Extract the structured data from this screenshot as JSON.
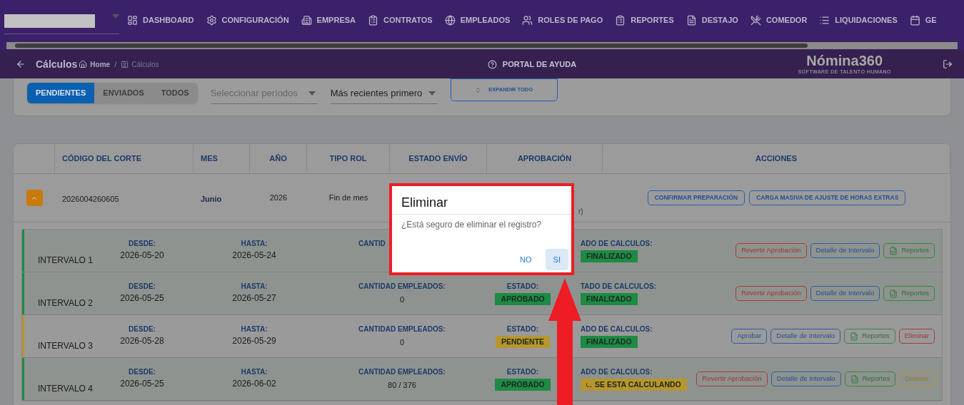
{
  "top_nav": {
    "items": [
      {
        "label": "DASHBOARD"
      },
      {
        "label": "CONFIGURACIÓN"
      },
      {
        "label": "EMPRESA"
      },
      {
        "label": "CONTRATOS"
      },
      {
        "label": "EMPLEADOS"
      },
      {
        "label": "ROLES DE PAGO"
      },
      {
        "label": "REPORTES"
      },
      {
        "label": "DESTAJO"
      },
      {
        "label": "COMEDOR"
      },
      {
        "label": "LIQUIDACIONES"
      },
      {
        "label": "GE"
      }
    ]
  },
  "header": {
    "title": "Cálculos",
    "breadcrumb": [
      "Home",
      "Cálculos"
    ],
    "breadcrumb_separator": "/",
    "help": "PORTAL DE AYUDA",
    "logo": {
      "name": "Nómina360",
      "tagline": "SOFTWARE DE TALENTO HUMANO"
    }
  },
  "filters": {
    "tabs": [
      {
        "label": "PENDIENTES",
        "selected": true
      },
      {
        "label": "ENVIADOS",
        "selected": false
      },
      {
        "label": "TODOS",
        "selected": false
      }
    ],
    "period": {
      "placeholder": "Seleccionar períodos"
    },
    "sort": {
      "value": "Más recientes primero"
    },
    "expand_button": "EXPANDIR TODO"
  },
  "table": {
    "columns": [
      "CÓDIGO DEL CORTE",
      "MES",
      "AÑO",
      "TIPO ROL",
      "ESTADO ENVÍO",
      "APROBACIÓN",
      "ACCIONES"
    ],
    "row": {
      "expanded": true,
      "code": "2026004260605",
      "month": "Junio",
      "year": "2026",
      "type": "Fin de mes",
      "approval_note": "r)",
      "actions": [
        "CONFIRMAR PREPARACIÓN",
        "CARGA MASIVA DE AJUSTE DE HORAS EXTRAS"
      ]
    }
  },
  "intervals": [
    {
      "name": "INTERVALO 1",
      "color": "#1e8a45",
      "desde_label": "DESDE:",
      "desde": "2026-05-20",
      "hasta_label": "HASTA:",
      "hasta": "2026-05-24",
      "cantidad_label": "CANTID",
      "calc_label": "ADO DE CALCULOS:",
      "calc": {
        "text": "FINALIZADO",
        "color": "#1e8a45",
        "loading": false
      },
      "actions": [
        {
          "label": "Revertir Aprobación",
          "kind": "danger"
        },
        {
          "label": "Detalle de Intervalo",
          "kind": "info"
        },
        {
          "label": "Reportes",
          "kind": "report"
        }
      ]
    },
    {
      "name": "INTERVALO 2",
      "color": "#1e8a45",
      "desde_label": "DESDE:",
      "desde": "2026-05-25",
      "hasta_label": "HASTA:",
      "hasta": "2026-05-27",
      "cantidad_label": "CANTIDAD EMPLEADOS:",
      "cantidad": "0",
      "estado_label": "ESTADO:",
      "estado": {
        "text": "APROBADO",
        "color": "#1e8a45"
      },
      "calc_label": "TADO DE CALCULOS:",
      "calc": {
        "text": "FINALIZADO",
        "color": "#1e8a45",
        "loading": false
      },
      "actions": [
        {
          "label": "Revertir Aprobación",
          "kind": "danger"
        },
        {
          "label": "Detalle de Intervalo",
          "kind": "info"
        },
        {
          "label": "Reportes",
          "kind": "report"
        }
      ]
    },
    {
      "name": "INTERVALO 3",
      "color": "#b8962e",
      "desde_label": "DESDE:",
      "desde": "2026-05-28",
      "hasta_label": "HASTA:",
      "hasta": "2026-05-29",
      "cantidad_label": "CANTIDAD EMPLEADOS:",
      "cantidad": "0",
      "estado_label": "ESTADO:",
      "estado": {
        "text": "PENDIENTE",
        "color": "#b8962e"
      },
      "calc_label": "ADO DE CALCULOS:",
      "calc": {
        "text": "FINALIZADO",
        "color": "#1e8a45",
        "loading": false
      },
      "actions": [
        {
          "label": "Aprobar",
          "kind": "info"
        },
        {
          "label": "Detalle de Intervalo",
          "kind": "info"
        },
        {
          "label": "Reportes",
          "kind": "report"
        },
        {
          "label": "Eliminar",
          "kind": "danger"
        }
      ]
    },
    {
      "name": "INTERVALO 4",
      "color": "#1e8a45",
      "desde_label": "DESDE:",
      "desde": "2026-05-25",
      "hasta_label": "HASTA:",
      "hasta": "2026-06-02",
      "cantidad_label": "CANTIDAD EMPLEADOS:",
      "cantidad": "80 / 376",
      "estado_label": "ESTADO:",
      "estado": {
        "text": "APROBADO",
        "color": "#1e8a45"
      },
      "calc_label": "ADO DE CALCULOS:",
      "calc": {
        "text": "SE ESTA CALCULANDO",
        "color": "#b8962e",
        "loading": true
      },
      "actions": [
        {
          "label": "Revertir Aprobación",
          "kind": "danger"
        },
        {
          "label": "Detalle de Intervalo",
          "kind": "info"
        },
        {
          "label": "Reportes",
          "kind": "report"
        },
        {
          "label": "Detener",
          "kind": "warning"
        }
      ]
    }
  ],
  "dialog": {
    "title": "Eliminar",
    "message": "¿Está seguro de eliminar el registro?",
    "buttons": [
      {
        "label": "NO",
        "selected": false
      },
      {
        "label": "SI",
        "selected": true
      }
    ]
  }
}
